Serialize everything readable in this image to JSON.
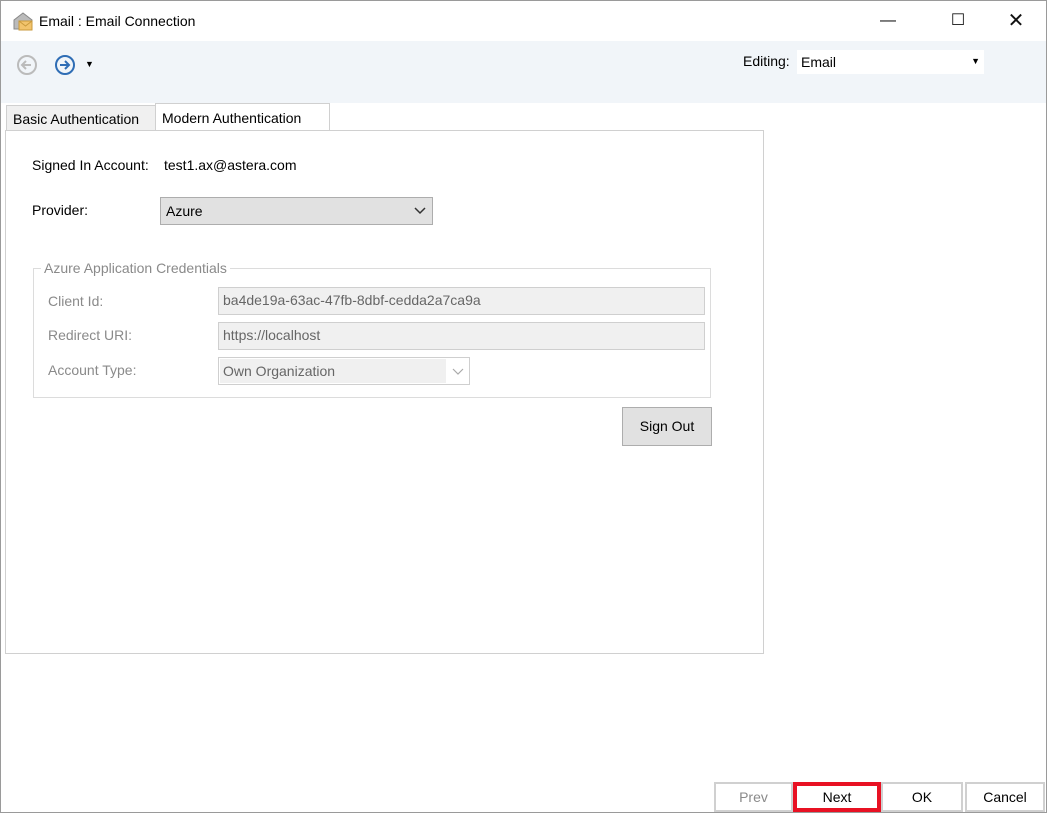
{
  "window": {
    "title": "Email : Email Connection",
    "icon": "email-envelope-icon"
  },
  "toolbar": {
    "back_icon": "arrow-left-circle-icon",
    "forward_icon": "arrow-right-circle-icon",
    "editing_label": "Editing:",
    "editing_value": "Email"
  },
  "tabs": [
    {
      "label": "Basic Authentication",
      "active": false
    },
    {
      "label": "Modern Authentication",
      "active": true
    }
  ],
  "form": {
    "signed_in_label": "Signed In Account:",
    "signed_in_value": "test1.ax@astera.com",
    "provider_label": "Provider:",
    "provider_value": "Azure",
    "group_title": "Azure Application Credentials",
    "client_id_label": "Client Id:",
    "client_id_value": "ba4de19a-63ac-47fb-8dbf-cedda2a7ca9a",
    "redirect_label": "Redirect URI:",
    "redirect_value": "https://localhost",
    "account_type_label": "Account Type:",
    "account_type_value": "Own Organization",
    "sign_out": "Sign Out"
  },
  "footer": {
    "prev": "Prev",
    "next": "Next",
    "ok": "OK",
    "cancel": "Cancel",
    "highlight_color": "#e81123"
  }
}
